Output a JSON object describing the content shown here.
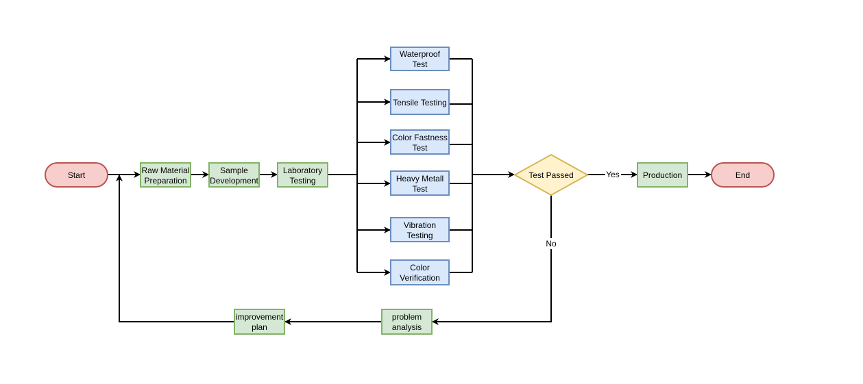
{
  "nodes": {
    "start": "Start",
    "raw_material": [
      "Raw Material",
      "Preparation"
    ],
    "sample": [
      "Sample",
      "Development"
    ],
    "laboratory": [
      "Laboratory",
      "Testing"
    ],
    "waterproof": [
      "Waterproof",
      "Test"
    ],
    "tensile": [
      "Tensile Testing"
    ],
    "color_fastness": [
      "Color Fastness",
      "Test"
    ],
    "heavy_metal": [
      "Heavy Metall",
      "Test"
    ],
    "vibration": [
      "Vibration",
      "Testing"
    ],
    "color_verification": [
      "Color",
      "Verification"
    ],
    "decision": "Test Passed",
    "production": "Production",
    "end": "End",
    "problem_analysis": [
      "problem",
      "analysis"
    ],
    "improvement_plan": [
      "improvement",
      "plan"
    ]
  },
  "edge_labels": {
    "yes": "Yes",
    "no": "No"
  },
  "colors": {
    "terminal_fill": "#f8cecc",
    "terminal_stroke": "#b85450",
    "process_fill": "#d5e8d4",
    "process_stroke": "#82b366",
    "test_fill": "#dae8fc",
    "test_stroke": "#6c8ebf",
    "decision_fill": "#fff2cc",
    "decision_stroke": "#d6b656"
  }
}
